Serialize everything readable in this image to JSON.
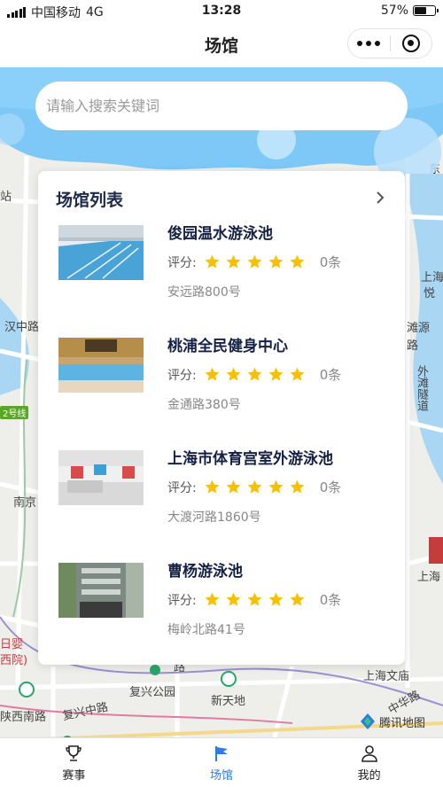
{
  "status_bar": {
    "carrier": "中国移动",
    "network": "4G",
    "time": "13:28",
    "battery": "57%",
    "battery_level": 0.57
  },
  "title_bar": {
    "title": "场馆"
  },
  "search": {
    "placeholder": "请输入搜索关键词"
  },
  "venue_list": {
    "title": "场馆列表",
    "rating_label": "评分:",
    "items": [
      {
        "name": "俊园温水游泳池",
        "stars": 5,
        "reviews": "0条",
        "address": "安远路800号"
      },
      {
        "name": "桃浦全民健身中心",
        "stars": 5,
        "reviews": "0条",
        "address": "金通路380号"
      },
      {
        "name": "上海市体育宫室外游泳池",
        "stars": 5,
        "reviews": "0条",
        "address": "大渡河路1860号"
      },
      {
        "name": "曹杨游泳池",
        "stars": 5,
        "reviews": "0条",
        "address": "梅岭北路41号"
      }
    ]
  },
  "map": {
    "labels": {
      "zhan": "站",
      "hanzhonglu": "汉中路",
      "line2": "2号线",
      "nanjing": "南京",
      "ri_ying": "日婴",
      "xiyuan": "西院)",
      "shaanxi": "陕西南路",
      "fuxing_mid": "复兴中路",
      "fuxing_park": "复兴公园",
      "xintiandi": "新天地",
      "shanghai_wenmiao": "上海文庙",
      "zhonghua": "中华路",
      "shanghai_right": "上海",
      "yue": "悦",
      "tanyuan": "滩源",
      "lu": "路",
      "waitan_tunnel": "外滩隧道",
      "shanghai_lower": "上海",
      "dong": "东",
      "road_r": "路"
    },
    "provider": "腾讯地图"
  },
  "tabs": [
    {
      "label": "赛事",
      "icon": "trophy-icon"
    },
    {
      "label": "场馆",
      "icon": "flag-icon"
    },
    {
      "label": "我的",
      "icon": "user-icon"
    }
  ],
  "colors": {
    "accent": "#2d7be5",
    "hero_blue": "#7ec8f7",
    "star": "#f7c000",
    "title": "#152046"
  }
}
